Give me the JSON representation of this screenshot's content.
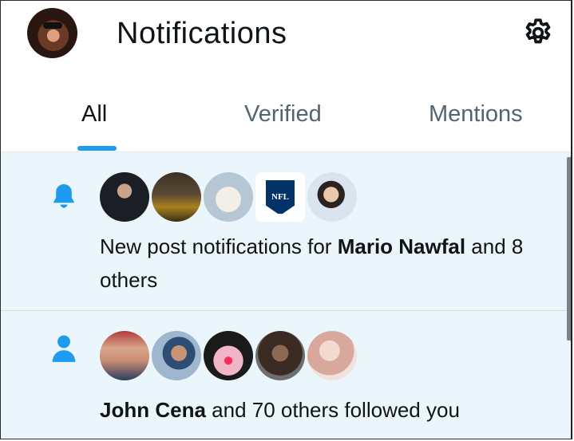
{
  "header": {
    "title": "Notifications",
    "icons": {
      "avatar": "profile-avatar",
      "settings": "gear-icon"
    }
  },
  "tabs": [
    {
      "label": "All",
      "active": true
    },
    {
      "label": "Verified",
      "active": false
    },
    {
      "label": "Mentions",
      "active": false
    }
  ],
  "notifications": [
    {
      "type_icon": "bell-icon",
      "name": "Mario Nawfal",
      "prefix": "New post notifications for ",
      "suffix": " and 8 others",
      "avatar_count": 5
    },
    {
      "type_icon": "person-icon",
      "name": "John Cena",
      "prefix": "",
      "suffix": " and 70 others followed you",
      "avatar_count": 5
    }
  ],
  "colors": {
    "accent": "#1d9bf0",
    "unread_bg": "#eaf6fb",
    "text": "#0f1419",
    "muted": "#536471"
  }
}
